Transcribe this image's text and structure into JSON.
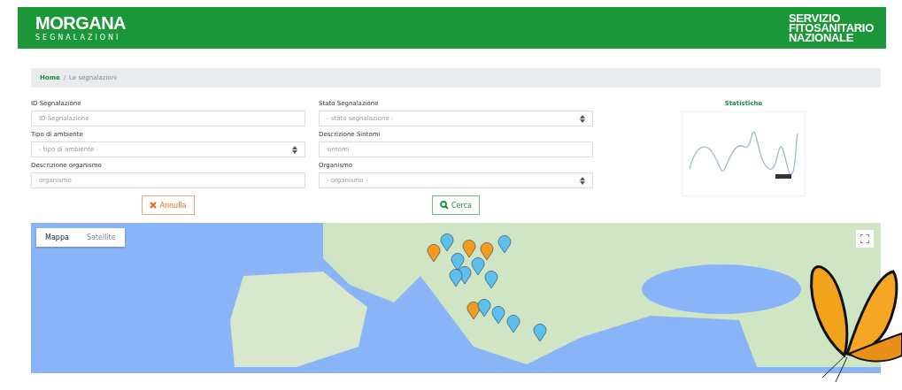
{
  "header": {
    "logo": "MORGANA",
    "logo_subtitle": "SEGNALAZIONI",
    "agency": [
      "SERVIZIO",
      "FITOSANITARIO",
      "NAZIONALE"
    ]
  },
  "breadcrumb": [
    {
      "label": "Home",
      "kind": "link"
    },
    {
      "label": "/",
      "kind": "separator"
    },
    {
      "label": "Le segnalazioni",
      "kind": "current"
    }
  ],
  "filters": [
    {
      "label": "ID Segnalazione",
      "kind": "input",
      "placeholder": "ID Segnalazione"
    },
    {
      "label": "Stato Segnalazione",
      "kind": "select",
      "placeholder": "- stato segnalazione -"
    },
    {
      "label": "Tipo di ambiente",
      "kind": "select",
      "placeholder": "- tipo di ambiente -"
    },
    {
      "label": "Descrizione Sintomi",
      "kind": "input",
      "placeholder": "sintomi"
    },
    {
      "label": "Descrizione organismo",
      "kind": "input",
      "placeholder": "organismo"
    },
    {
      "label": "Organismo",
      "kind": "select",
      "placeholder": "- organismo -"
    }
  ],
  "buttons": [
    {
      "label": "Annulla",
      "kind": "cancel"
    },
    {
      "label": "Cerca",
      "kind": "search"
    }
  ],
  "statistics": {
    "title": "Statistiche"
  },
  "map": {
    "types": [
      {
        "label": "Mappa",
        "selected": true
      },
      {
        "label": "Satellite",
        "selected": false
      }
    ]
  }
}
